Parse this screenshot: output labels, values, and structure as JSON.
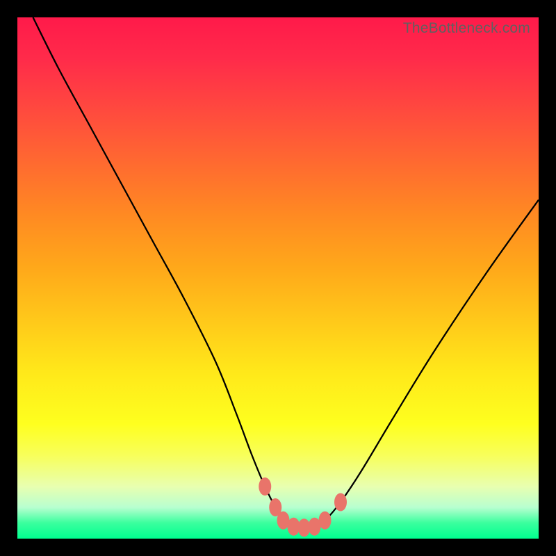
{
  "watermark": "TheBottleneck.com",
  "chart_data": {
    "type": "line",
    "title": "",
    "xlabel": "",
    "ylabel": "",
    "xlim": [
      0,
      100
    ],
    "ylim": [
      0,
      100
    ],
    "curve": {
      "x": [
        3,
        8,
        14,
        20,
        26,
        32,
        38,
        42,
        45,
        47.5,
        49.5,
        51,
        53,
        55,
        57,
        59,
        62,
        66,
        72,
        80,
        90,
        100
      ],
      "y": [
        100,
        90,
        79,
        68,
        57,
        46,
        34,
        24,
        16,
        10,
        6,
        3.5,
        2.3,
        2.1,
        2.3,
        3.5,
        7,
        13,
        23,
        36,
        51,
        65
      ]
    },
    "markers": {
      "x": [
        47.5,
        49.5,
        51,
        53,
        55,
        57,
        59,
        62
      ],
      "y": [
        10,
        6,
        3.5,
        2.3,
        2.1,
        2.3,
        3.5,
        7
      ]
    },
    "gradient_meaning": "red = high bottleneck, green = balanced"
  }
}
